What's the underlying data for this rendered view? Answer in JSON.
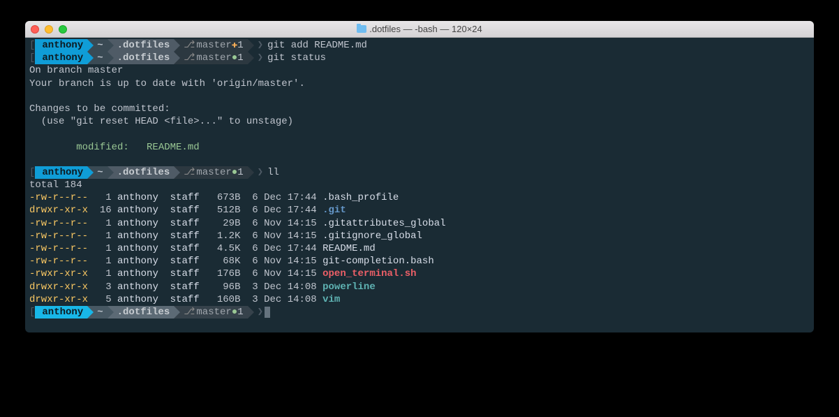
{
  "window": {
    "title": ".dotfiles — -bash — 120×24"
  },
  "prompts": [
    {
      "user": "anthony",
      "home": "~",
      "dir": ".dotfiles",
      "branch": "master",
      "status_symbol": "✚",
      "status_class": "plus",
      "count": "1",
      "command": "git add README.md"
    },
    {
      "user": "anthony",
      "home": "~",
      "dir": ".dotfiles",
      "branch": "master",
      "status_symbol": "●",
      "status_class": "dot-green",
      "count": "1",
      "command": "git status"
    },
    {
      "user": "anthony",
      "home": "~",
      "dir": ".dotfiles",
      "branch": "master",
      "status_symbol": "●",
      "status_class": "dot-green",
      "count": "1",
      "command": "ll"
    },
    {
      "user": "anthony",
      "home": "~",
      "dir": ".dotfiles",
      "branch": "master",
      "status_symbol": "●",
      "status_class": "dot-green",
      "count": "1",
      "command": ""
    }
  ],
  "git_output": {
    "l1": "On branch master",
    "l2": "Your branch is up to date with 'origin/master'.",
    "l3": "Changes to be committed:",
    "l4": "  (use \"git reset HEAD <file>...\" to unstage)",
    "l5": "        modified:   README.md"
  },
  "ll": {
    "total": "total 184",
    "rows": [
      {
        "perm": "-rw-r--r--",
        "links": "  1",
        "owner": "anthony",
        "group": "staff",
        "size": "  673B",
        "date": " 6 Dec 17:44",
        "name": ".bash_profile",
        "cls": "ls-name-default"
      },
      {
        "perm": "drwxr-xr-x",
        "links": " 16",
        "owner": "anthony",
        "group": "staff",
        "size": "  512B",
        "date": " 6 Dec 17:44",
        "name": ".git",
        "cls": "ls-name-dir"
      },
      {
        "perm": "-rw-r--r--",
        "links": "  1",
        "owner": "anthony",
        "group": "staff",
        "size": "   29B",
        "date": " 6 Nov 14:15",
        "name": ".gitattributes_global",
        "cls": "ls-name-default"
      },
      {
        "perm": "-rw-r--r--",
        "links": "  1",
        "owner": "anthony",
        "group": "staff",
        "size": "  1.2K",
        "date": " 6 Nov 14:15",
        "name": ".gitignore_global",
        "cls": "ls-name-default"
      },
      {
        "perm": "-rw-r--r--",
        "links": "  1",
        "owner": "anthony",
        "group": "staff",
        "size": "  4.5K",
        "date": " 6 Dec 17:44",
        "name": "README.md",
        "cls": "ls-name-default"
      },
      {
        "perm": "-rw-r--r--",
        "links": "  1",
        "owner": "anthony",
        "group": "staff",
        "size": "   68K",
        "date": " 6 Nov 14:15",
        "name": "git-completion.bash",
        "cls": "ls-name-default"
      },
      {
        "perm": "-rwxr-xr-x",
        "links": "  1",
        "owner": "anthony",
        "group": "staff",
        "size": "  176B",
        "date": " 6 Nov 14:15",
        "name": "open_terminal.sh",
        "cls": "ls-name-exec"
      },
      {
        "perm": "drwxr-xr-x",
        "links": "  3",
        "owner": "anthony",
        "group": "staff",
        "size": "   96B",
        "date": " 3 Dec 14:08",
        "name": "powerline",
        "cls": "ls-name-cyan"
      },
      {
        "perm": "drwxr-xr-x",
        "links": "  5",
        "owner": "anthony",
        "group": "staff",
        "size": "  160B",
        "date": " 3 Dec 14:08",
        "name": "vim",
        "cls": "ls-name-cyan"
      }
    ]
  }
}
